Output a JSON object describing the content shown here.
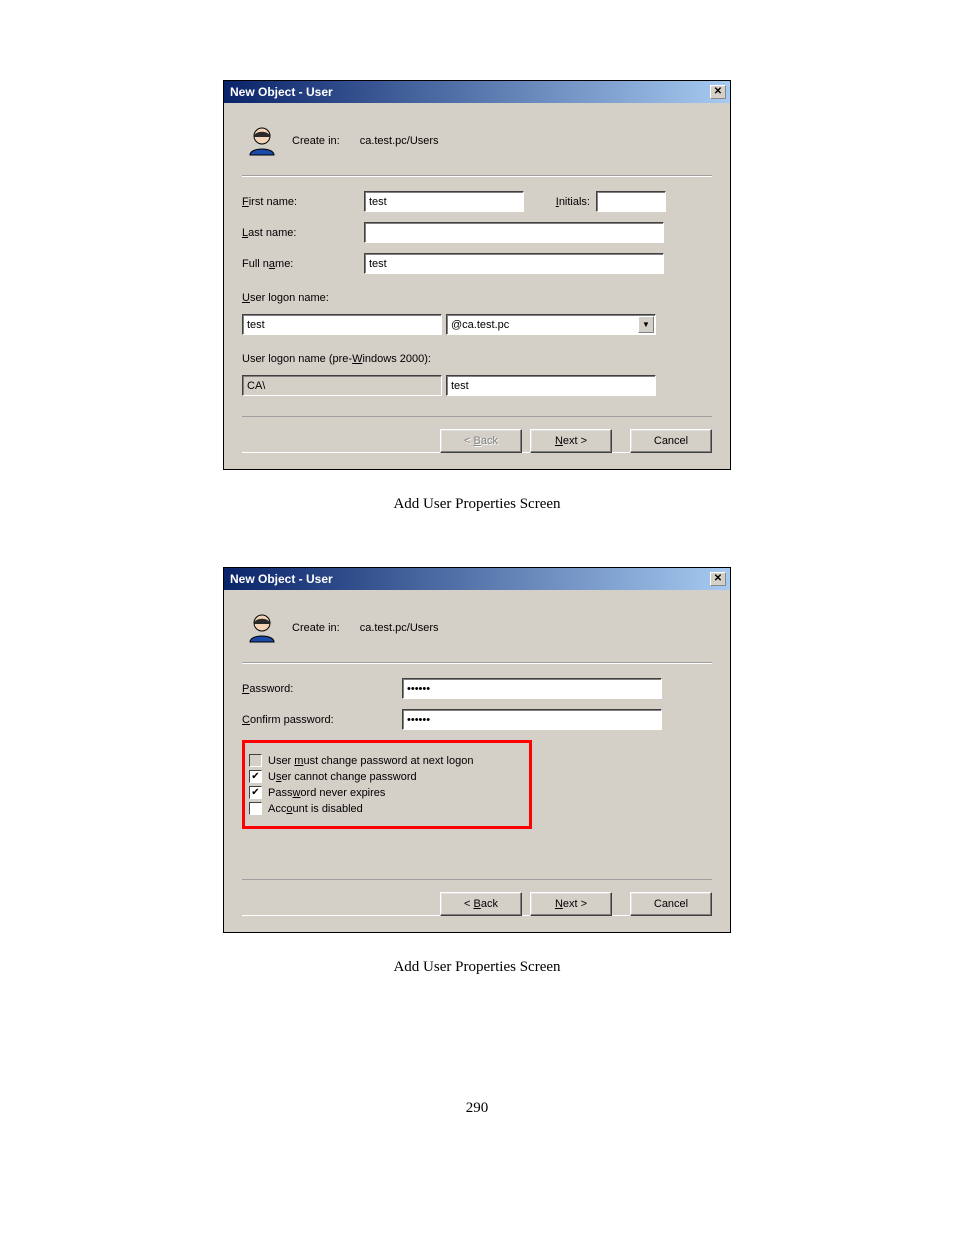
{
  "page_number": "290",
  "caption": "Add User Properties Screen",
  "dialog1": {
    "title": "New Object - User",
    "create_in_label": "Create in:",
    "create_in_path": "ca.test.pc/Users",
    "first_name_label_pre": "F",
    "first_name_label": "irst name:",
    "first_name_value": "test",
    "initials_label_pre": "I",
    "initials_label": "nitials:",
    "initials_value": "",
    "last_name_label_pre": "L",
    "last_name_label": "ast name:",
    "last_name_value": "",
    "full_name_label": "Full n",
    "full_name_label_u": "a",
    "full_name_label_post": "me:",
    "full_name_value": "test",
    "user_logon_label_pre": "U",
    "user_logon_label": "ser logon name:",
    "user_logon_value": "test",
    "domain_value": "@ca.test.pc",
    "pre2000_label": "User logon name (pre-",
    "pre2000_label_u": "W",
    "pre2000_label_post": "indows 2000):",
    "pre2000_domain": "CA\\",
    "pre2000_user": "test",
    "back_u": "B",
    "back": "ack",
    "back_pre": "< ",
    "next_u": "N",
    "next": "ext >",
    "cancel": "Cancel"
  },
  "dialog2": {
    "title": "New Object - User",
    "create_in_label": "Create in:",
    "create_in_path": "ca.test.pc/Users",
    "password_label_pre": "P",
    "password_label": "assword:",
    "password_value": "••••••",
    "confirm_label_pre": "C",
    "confirm_label": "onfirm password:",
    "confirm_value": "••••••",
    "chk1_pre": "User ",
    "chk1_u": "m",
    "chk1_post": "ust change password at next logon",
    "chk1_checked": false,
    "chk2_pre": "U",
    "chk2_u": "s",
    "chk2_post": "er cannot change password",
    "chk2_checked": true,
    "chk3_pre": "Pass",
    "chk3_u": "w",
    "chk3_post": "ord never expires",
    "chk3_checked": true,
    "chk4_pre": "Acc",
    "chk4_u": "o",
    "chk4_post": "unt is disabled",
    "chk4_checked": false,
    "back_u": "B",
    "back": "ack",
    "back_pre": "< ",
    "next_u": "N",
    "next": "ext >",
    "cancel": "Cancel"
  }
}
